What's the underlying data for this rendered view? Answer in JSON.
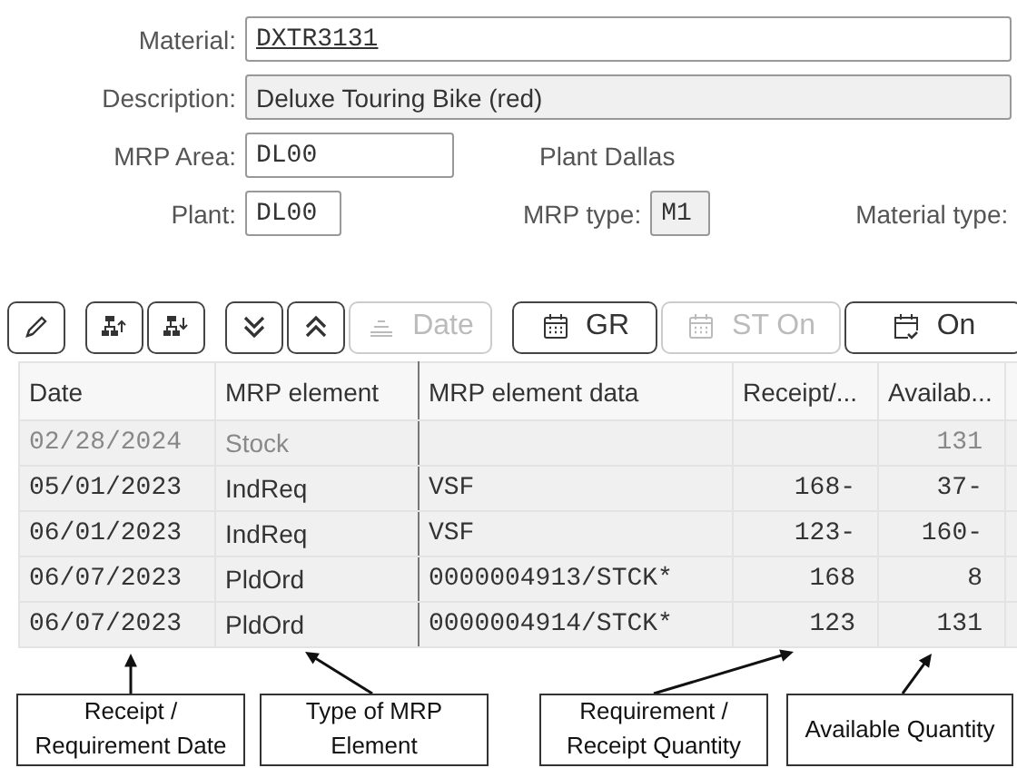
{
  "form": {
    "rows": [
      [
        {
          "kind": "link",
          "label": "Material:",
          "value": "DXTR3131"
        }
      ],
      [
        {
          "kind": "readonly",
          "label": "Description:",
          "value": "Deluxe Touring Bike (red)"
        }
      ],
      [
        {
          "kind": "input",
          "label": "MRP Area:",
          "value": "DL00"
        },
        {
          "kind": "text",
          "text": "Plant Dallas"
        }
      ],
      [
        {
          "kind": "input",
          "label": "Plant:",
          "value": "DL00"
        },
        {
          "kind": "readonly",
          "label": "MRP type:",
          "value": "M1"
        },
        {
          "kind": "label",
          "label": "Material type:"
        }
      ]
    ]
  },
  "toolbar": [
    [
      {
        "disabled": false
      }
    ],
    [
      {
        "disabled": false
      },
      {
        "disabled": false
      }
    ],
    [
      {
        "disabled": false
      },
      {
        "disabled": false
      },
      {
        "label": "Date",
        "disabled": true
      }
    ],
    [
      {
        "label": "GR",
        "disabled": false
      },
      {
        "label": "ST On",
        "disabled": true
      },
      {
        "label": "On",
        "disabled": false
      }
    ]
  ],
  "table": {
    "columns": [
      "Date",
      "MRP element",
      "MRP element data",
      "Receipt/...",
      "Availab..."
    ],
    "rows": [
      {
        "dimmed": true,
        "cells": [
          "02/28/2024",
          "Stock",
          "",
          "",
          "131"
        ]
      },
      {
        "dimmed": false,
        "cells": [
          "05/01/2023",
          "IndReq",
          "VSF",
          "168-",
          "37-"
        ]
      },
      {
        "dimmed": false,
        "cells": [
          "06/01/2023",
          "IndReq",
          "VSF",
          "123-",
          "160-"
        ]
      },
      {
        "dimmed": false,
        "cells": [
          "06/07/2023",
          "PldOrd",
          "0000004913/STCK*",
          "168",
          "8"
        ]
      },
      {
        "dimmed": false,
        "cells": [
          "06/07/2023",
          "PldOrd",
          "0000004914/STCK*",
          "123",
          "131"
        ]
      }
    ]
  },
  "callouts": [
    "Receipt / Requirement Date",
    "Type of MRP Element",
    "Requirement / Receipt Quantity",
    "Available Quantity"
  ]
}
